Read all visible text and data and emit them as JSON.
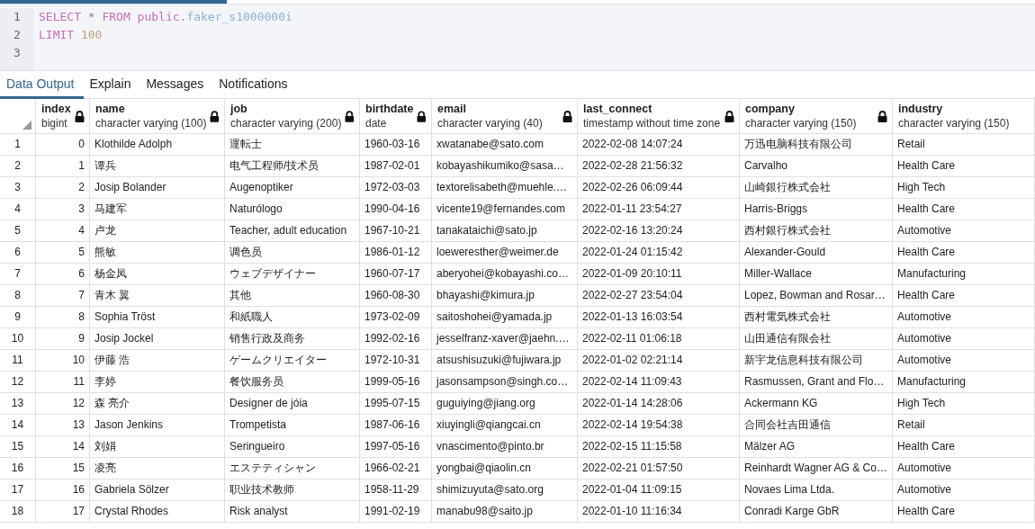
{
  "editor": {
    "lines": [
      {
        "number": "1",
        "tokens": [
          {
            "text": "SELECT ",
            "kind": "keyword"
          },
          {
            "text": "* ",
            "kind": "operator"
          },
          {
            "text": "FROM ",
            "kind": "keyword"
          },
          {
            "text": "public.",
            "kind": "keyword"
          },
          {
            "text": "faker_s1000000i",
            "kind": "identifier"
          }
        ]
      },
      {
        "number": "2",
        "tokens": [
          {
            "text": "LIMIT ",
            "kind": "keyword"
          },
          {
            "text": "100",
            "kind": "number"
          }
        ]
      },
      {
        "number": "3"
      }
    ]
  },
  "tabs": [
    {
      "label": "Data Output",
      "selected": true
    },
    {
      "label": "Explain",
      "selected": false
    },
    {
      "label": "Messages",
      "selected": false
    },
    {
      "label": "Notifications",
      "selected": false
    }
  ],
  "table": {
    "columns": [
      {
        "name": "index",
        "type": "bigint",
        "locked": true
      },
      {
        "name": "name",
        "type": "character varying (100)",
        "locked": true
      },
      {
        "name": "job",
        "type": "character varying (200)",
        "locked": true
      },
      {
        "name": "birthdate",
        "type": "date",
        "locked": true
      },
      {
        "name": "email",
        "type": "character varying (40)",
        "locked": true
      },
      {
        "name": "last_connect",
        "type": "timestamp without time zone",
        "locked": true
      },
      {
        "name": "company",
        "type": "character varying (150)",
        "locked": true
      },
      {
        "name": "industry",
        "type": "character varying (150)",
        "locked": false
      }
    ],
    "rows": [
      {
        "number": "1",
        "cells": [
          "0",
          "Klothilde Adolph",
          "運転士",
          "1960-03-16",
          "xwatanabe@sato.com",
          "2022-02-08 14:07:24",
          "万迅电脑科技有限公司",
          "Retail"
        ]
      },
      {
        "number": "2",
        "cells": [
          "1",
          "谭兵",
          "电气工程师/技术员",
          "1987-02-01",
          "kobayashikumiko@sasa…",
          "2022-02-28 21:56:32",
          "Carvalho",
          "Health Care"
        ]
      },
      {
        "number": "3",
        "cells": [
          "2",
          "Josip Bolander",
          "Augenoptiker",
          "1972-03-03",
          "textorelisabeth@muehle.…",
          "2022-02-26 06:09:44",
          "山崎銀行株式会社",
          "High Tech"
        ]
      },
      {
        "number": "4",
        "cells": [
          "3",
          "马建军",
          "Naturólogo",
          "1990-04-16",
          "vicente19@fernandes.com",
          "2022-01-11 23:54:27",
          "Harris-Briggs",
          "Health Care"
        ]
      },
      {
        "number": "5",
        "cells": [
          "4",
          "卢龙",
          "Teacher, adult education",
          "1967-10-21",
          "tanakataichi@sato.jp",
          "2022-02-16 13:20:24",
          "西村銀行株式会社",
          "Automotive"
        ]
      },
      {
        "number": "6",
        "cells": [
          "5",
          "熊敏",
          "调色员",
          "1986-01-12",
          "loeweresther@weimer.de",
          "2022-01-24 01:15:42",
          "Alexander-Gould",
          "Health Care"
        ]
      },
      {
        "number": "7",
        "cells": [
          "6",
          "杨金凤",
          "ウェブデザイナー",
          "1960-07-17",
          "aberyohei@kobayashi.co…",
          "2022-01-09 20:10:11",
          "Miller-Wallace",
          "Manufacturing"
        ]
      },
      {
        "number": "8",
        "cells": [
          "7",
          "青木 翼",
          "其他",
          "1960-08-30",
          "bhayashi@kimura.jp",
          "2022-02-27 23:54:04",
          "Lopez, Bowman and Rosar…",
          "Health Care"
        ]
      },
      {
        "number": "9",
        "cells": [
          "8",
          "Sophia Tröst",
          "和紙職人",
          "1973-02-09",
          "saitoshohei@yamada.jp",
          "2022-01-13 16:03:54",
          "西村電気株式会社",
          "Automotive"
        ]
      },
      {
        "number": "10",
        "cells": [
          "9",
          "Josip Jockel",
          "销售行政及商务",
          "1992-02-16",
          "jesselfranz-xaver@jaehn.…",
          "2022-02-11 01:06:18",
          "山田通信有限会社",
          "Automotive"
        ]
      },
      {
        "number": "11",
        "cells": [
          "10",
          "伊藤 浩",
          "ゲームクリエイター",
          "1972-10-31",
          "atsushisuzuki@fujiwara.jp",
          "2022-01-02 02:21:14",
          "新宇龙信息科技有限公司",
          "Automotive"
        ]
      },
      {
        "number": "12",
        "cells": [
          "11",
          "李婷",
          "餐饮服务员",
          "1999-05-16",
          "jasonsampson@singh.co…",
          "2022-02-14 11:09:43",
          "Rasmussen, Grant and Flo…",
          "Manufacturing"
        ]
      },
      {
        "number": "13",
        "cells": [
          "12",
          "森 亮介",
          "Designer de jóia",
          "1995-07-15",
          "guguiying@jiang.org",
          "2022-01-14 14:28:06",
          "Ackermann KG",
          "High Tech"
        ]
      },
      {
        "number": "14",
        "cells": [
          "13",
          "Jason Jenkins",
          "Trompetista",
          "1987-06-16",
          "xiuyingli@qiangcai.cn",
          "2022-02-14 19:54:38",
          "合同会社吉田通信",
          "Retail"
        ]
      },
      {
        "number": "15",
        "cells": [
          "14",
          "刘娟",
          "Seringueiro",
          "1997-05-16",
          "vnascimento@pinto.br",
          "2022-02-15 11:15:58",
          "Mälzer AG",
          "Health Care"
        ]
      },
      {
        "number": "16",
        "cells": [
          "15",
          "凌亮",
          "エステティシャン",
          "1966-02-21",
          "yongbai@qiaolin.cn",
          "2022-02-21 01:57:50",
          "Reinhardt Wagner AG & Co…",
          "Automotive"
        ]
      },
      {
        "number": "17",
        "cells": [
          "16",
          "Gabriela Sölzer",
          "职业技术教师",
          "1958-11-29",
          "shimizuyuta@sato.org",
          "2022-01-04 11:09:15",
          "Novaes Lima Ltda.",
          "Automotive"
        ]
      },
      {
        "number": "18",
        "cells": [
          "17",
          "Crystal Rhodes",
          "Risk analyst",
          "1991-02-19",
          "manabu98@saito.jp",
          "2022-01-10 11:16:34",
          "Conradi Karge GbR",
          "Health Care"
        ]
      }
    ]
  }
}
